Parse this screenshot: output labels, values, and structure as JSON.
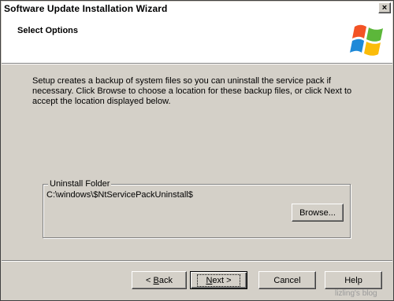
{
  "window": {
    "title": "Software Update Installation Wizard",
    "close_label": "×"
  },
  "header": {
    "title": "Select Options",
    "logo_icon": "windows-flag-icon",
    "colors": {
      "red": "#f35325",
      "green": "#5cb73a",
      "blue": "#1e89d8",
      "yellow": "#fbbc09"
    }
  },
  "main": {
    "description": "Setup creates a backup of system files so you can uninstall the service pack if necessary.  Click Browse to choose a location for these backup files, or click Next to accept the location displayed below.",
    "uninstall_folder": {
      "legend": "Uninstall Folder",
      "path": "C:\\windows\\$NtServicePackUninstall$",
      "browse_label": "Browse..."
    }
  },
  "footer": {
    "back_prefix": "< ",
    "back_accel": "B",
    "back_rest": "ack",
    "next_accel": "N",
    "next_rest": "ext >",
    "cancel_label": "Cancel",
    "help_label": "Help"
  },
  "watermark": "lizling's blog"
}
